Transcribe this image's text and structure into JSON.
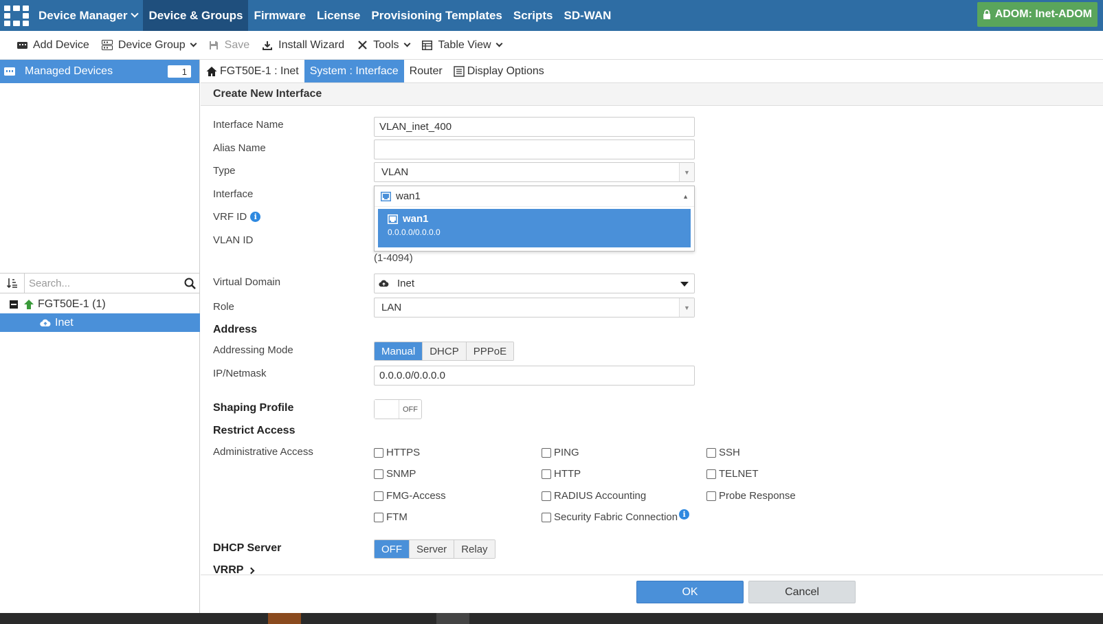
{
  "topnav": {
    "app_label": "Device Manager",
    "items": [
      "Device & Groups",
      "Firmware",
      "License",
      "Provisioning Templates",
      "Scripts",
      "SD-WAN"
    ],
    "adom_label": "ADOM: Inet-ADOM"
  },
  "toolbar": {
    "add_device": "Add Device",
    "device_group": "Device Group",
    "save": "Save",
    "install_wizard": "Install Wizard",
    "tools": "Tools",
    "table_view": "Table View"
  },
  "sidebar": {
    "managed_devices_label": "Managed Devices",
    "managed_devices_count": "1",
    "search_placeholder": "Search...",
    "tree": {
      "device": "FGT50E-1 (1)",
      "vdom": "Inet"
    }
  },
  "tabs": {
    "device_tab": "FGT50E-1 : Inet",
    "interface_tab": "System : Interface",
    "router_tab": "Router",
    "display_options": "Display Options"
  },
  "form": {
    "title": "Create New Interface",
    "interface_name_label": "Interface Name",
    "interface_name_value": "VLAN_inet_400",
    "alias_name_label": "Alias Name",
    "alias_name_value": "",
    "type_label": "Type",
    "type_value": "VLAN",
    "interface_label": "Interface",
    "interface_value": "wan1",
    "interface_option_name": "wan1",
    "interface_option_ip": "0.0.0.0/0.0.0.0",
    "vrf_id_label": "VRF ID",
    "vlan_id_label": "VLAN ID",
    "vlan_id_hint": "(1-4094)",
    "virtual_domain_label": "Virtual Domain",
    "virtual_domain_value": "Inet",
    "role_label": "Role",
    "role_value": "LAN",
    "address_heading": "Address",
    "addressing_mode_label": "Addressing Mode",
    "addressing_modes": [
      "Manual",
      "DHCP",
      "PPPoE"
    ],
    "addressing_mode_selected": "Manual",
    "ip_netmask_label": "IP/Netmask",
    "ip_netmask_value": "0.0.0.0/0.0.0.0",
    "shaping_profile_label": "Shaping Profile",
    "shaping_profile_toggle": "OFF",
    "restrict_access_heading": "Restrict Access",
    "admin_access_label": "Administrative Access",
    "admin_access": {
      "https": "HTTPS",
      "ping": "PING",
      "ssh": "SSH",
      "snmp": "SNMP",
      "http": "HTTP",
      "telnet": "TELNET",
      "fmg_access": "FMG-Access",
      "radius": "RADIUS Accounting",
      "probe": "Probe Response",
      "ftm": "FTM",
      "security_fabric": "Security Fabric Connection"
    },
    "dhcp_server_label": "DHCP Server",
    "dhcp_modes": [
      "OFF",
      "Server",
      "Relay"
    ],
    "dhcp_mode_selected": "OFF",
    "vrrp_label": "VRRP"
  },
  "footer": {
    "ok": "OK",
    "cancel": "Cancel"
  },
  "colors": {
    "nav_bg": "#2e6da4",
    "nav_active": "#1f4f7d",
    "accent": "#4a90d9",
    "adom_bg": "#5aa55b"
  }
}
